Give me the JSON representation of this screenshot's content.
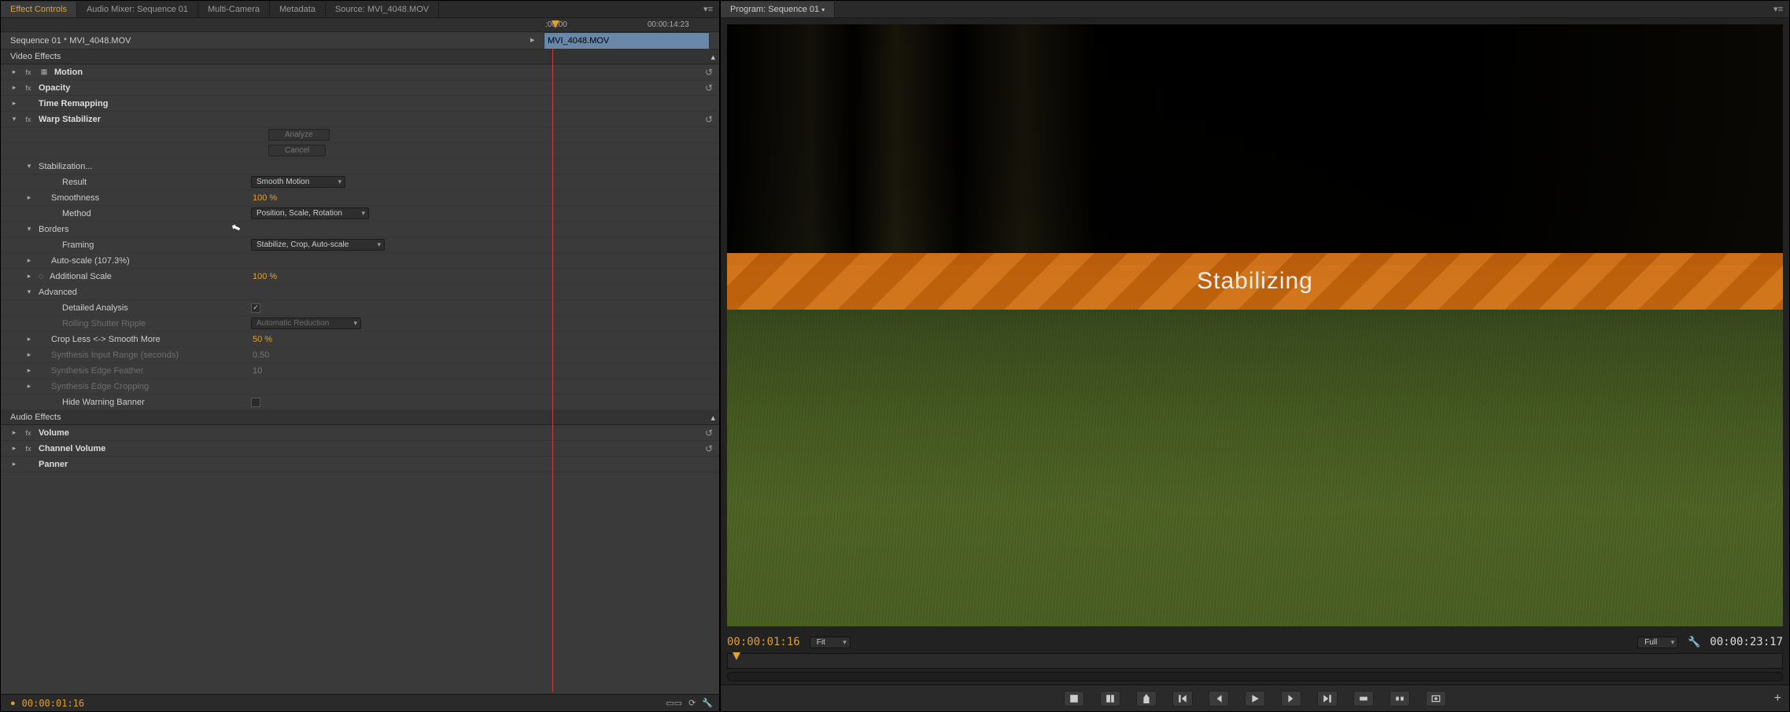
{
  "left": {
    "tabs": [
      "Effect Controls",
      "Audio Mixer: Sequence 01",
      "Multi-Camera",
      "Metadata",
      "Source: MVI_4048.MOV"
    ],
    "active_tab": 0,
    "sequence_line": "Sequence 01 * MVI_4048.MOV",
    "clip_chip": "MVI_4048.MOV",
    "ruler": {
      "t0": ":00:00",
      "t1": "00:00:14:23"
    },
    "video_effects_header": "Video Effects",
    "audio_effects_header": "Audio Effects",
    "effects": {
      "motion": "Motion",
      "opacity": "Opacity",
      "time_remapping": "Time Remapping",
      "warp": "Warp Stabilizer",
      "volume": "Volume",
      "channel_volume": "Channel Volume",
      "panner": "Panner"
    },
    "warp": {
      "analyze_btn": "Analyze",
      "cancel_btn": "Cancel",
      "stabilization_grp": "Stabilization...",
      "result_lbl": "Result",
      "result_val": "Smooth Motion",
      "smoothness_lbl": "Smoothness",
      "smoothness_val": "100 %",
      "method_lbl": "Method",
      "method_val": "Position, Scale, Rotation",
      "borders_grp": "Borders",
      "framing_lbl": "Framing",
      "framing_val": "Stabilize, Crop, Auto-scale",
      "autoscale_lbl": "Auto-scale (107.3%)",
      "addscale_lbl": "Additional Scale",
      "addscale_val": "100 %",
      "advanced_grp": "Advanced",
      "detailed_lbl": "Detailed Analysis",
      "detailed_chk": "✓",
      "rsr_lbl": "Rolling Shutter Ripple",
      "rsr_val": "Automatic Reduction",
      "cropless_lbl": "Crop Less <-> Smooth More",
      "cropless_val": "50 %",
      "synthrange_lbl": "Synthesis Input Range (seconds)",
      "synthrange_val": "0.50",
      "synthfeather_lbl": "Synthesis Edge Feather",
      "synthfeather_val": "10",
      "synthcrop_lbl": "Synthesis Edge Cropping",
      "hide_lbl": "Hide Warning Banner"
    },
    "footer_tc": "00:00:01:16"
  },
  "right": {
    "tab": "Program: Sequence 01",
    "banner": "Stabilizing",
    "tc_left": "00:00:01:16",
    "fit": "Fit",
    "quality": "Full",
    "tc_right": "00:00:23:17"
  }
}
